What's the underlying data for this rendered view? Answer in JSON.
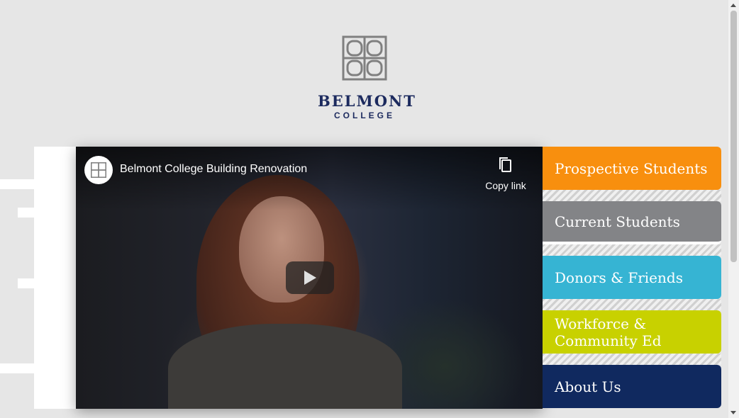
{
  "logo": {
    "name": "BELMONT",
    "sub": "COLLEGE"
  },
  "video": {
    "title": "Belmont College Building Renovation",
    "copy_link_label": "Copy link",
    "play_icon": "play-icon",
    "copy_icon": "copy-icon"
  },
  "nav": {
    "items": [
      {
        "label": "Prospective Students",
        "color": "#f88f0e"
      },
      {
        "label": "Current Students",
        "color": "#838487"
      },
      {
        "label": "Donors & Friends",
        "color": "#36b4d3"
      },
      {
        "label": "Workforce & Community Ed",
        "color": "#c8d100"
      },
      {
        "label": "About Us",
        "color": "#10295f"
      }
    ]
  },
  "colors": {
    "brand_navy": "#1c2a5e",
    "page_bg": "#e6e6e6"
  }
}
